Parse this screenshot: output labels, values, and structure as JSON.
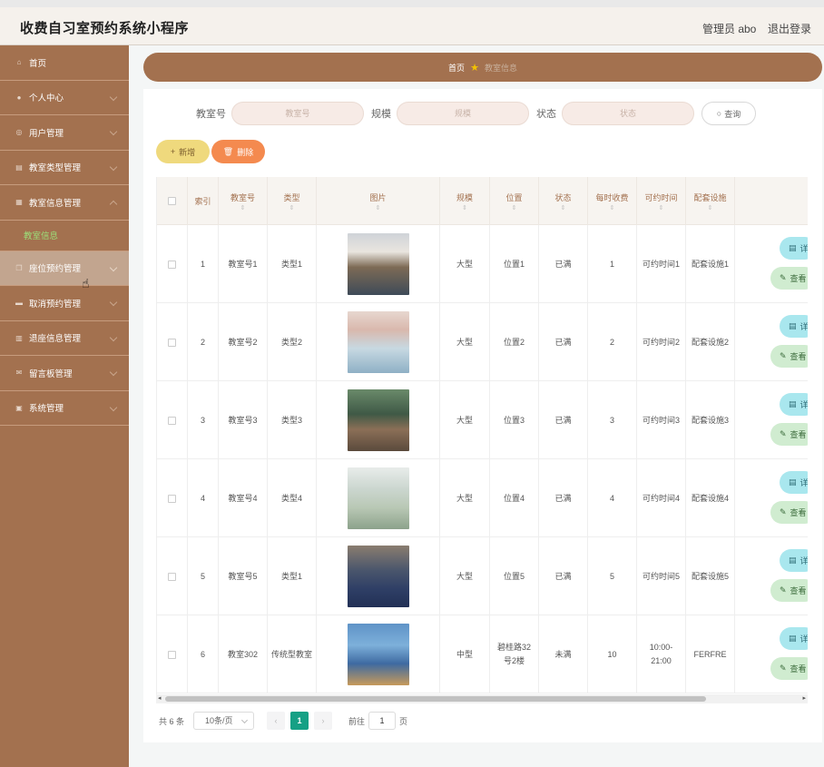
{
  "header": {
    "title": "收费自习室预约系统小程序",
    "admin": "管理员 abo",
    "logout": "退出登录"
  },
  "sidebar": {
    "items": [
      {
        "label": "首页",
        "icon": "home-icon"
      },
      {
        "label": "个人中心",
        "icon": "user-icon"
      },
      {
        "label": "用户管理",
        "icon": "users-icon"
      },
      {
        "label": "教室类型管理",
        "icon": "list-icon"
      },
      {
        "label": "教室信息管理",
        "icon": "grid-icon"
      },
      {
        "label": "座位预约管理",
        "icon": "copy-icon"
      },
      {
        "label": "取消预约管理",
        "icon": "monitor-icon"
      },
      {
        "label": "退座信息管理",
        "icon": "doc-icon"
      },
      {
        "label": "留言板管理",
        "icon": "mail-icon"
      },
      {
        "label": "系统管理",
        "icon": "db-icon"
      }
    ],
    "submenu": "教室信息"
  },
  "breadcrumb": {
    "home": "首页",
    "current": "教室信息"
  },
  "search": {
    "label1": "教室号",
    "placeholder1": "教室号",
    "label2": "规模",
    "placeholder2": "规模",
    "label3": "状态",
    "placeholder3": "状态",
    "button": "查询"
  },
  "actions": {
    "add": "新增",
    "delete": "删除",
    "detail": "详",
    "view": "查看"
  },
  "table": {
    "columns": [
      "索引",
      "教室号",
      "类型",
      "图片",
      "规模",
      "位置",
      "状态",
      "每时收费",
      "可约时间",
      "配套设施"
    ],
    "rows": [
      {
        "index": "1",
        "room": "教室号1",
        "type": "类型1",
        "scale": "大型",
        "location": "位置1",
        "status": "已满",
        "fee": "1",
        "time": "可约时间1",
        "facility": "配套设施1"
      },
      {
        "index": "2",
        "room": "教室号2",
        "type": "类型2",
        "scale": "大型",
        "location": "位置2",
        "status": "已满",
        "fee": "2",
        "time": "可约时间2",
        "facility": "配套设施2"
      },
      {
        "index": "3",
        "room": "教室号3",
        "type": "类型3",
        "scale": "大型",
        "location": "位置3",
        "status": "已满",
        "fee": "3",
        "time": "可约时间3",
        "facility": "配套设施3"
      },
      {
        "index": "4",
        "room": "教室号4",
        "type": "类型4",
        "scale": "大型",
        "location": "位置4",
        "status": "已满",
        "fee": "4",
        "time": "可约时间4",
        "facility": "配套设施4"
      },
      {
        "index": "5",
        "room": "教室号5",
        "type": "类型1",
        "scale": "大型",
        "location": "位置5",
        "status": "已满",
        "fee": "5",
        "time": "可约时间5",
        "facility": "配套设施5"
      },
      {
        "index": "6",
        "room": "教室302",
        "type": "传统型教室",
        "scale": "中型",
        "location": "碧桂路32号2楼",
        "status": "未满",
        "fee": "10",
        "time": "10:00-21:00",
        "facility": "FERFRE"
      }
    ]
  },
  "pager": {
    "total": "共 6 条",
    "size": "10条/页",
    "prev": "‹",
    "page": "1",
    "next": "›",
    "goto": "前往",
    "goto_value": "1",
    "page_unit": "页"
  }
}
